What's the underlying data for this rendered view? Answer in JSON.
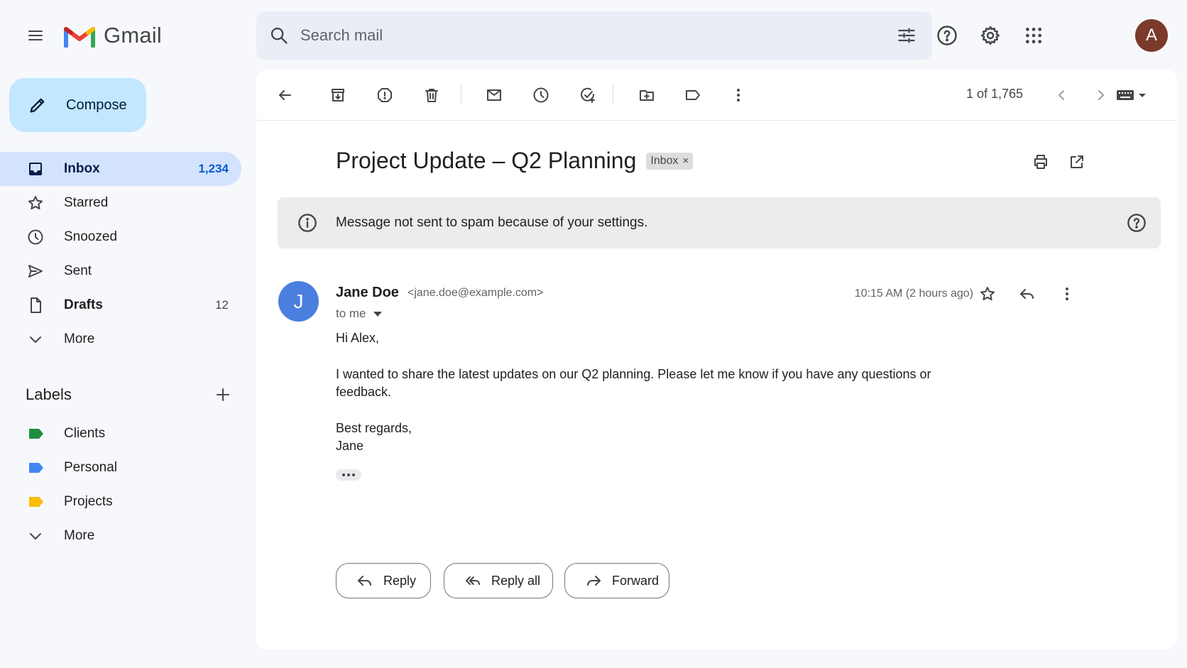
{
  "app": {
    "name": "Gmail"
  },
  "header": {
    "search_placeholder": "Search mail",
    "avatar_initial": "A",
    "icons": [
      "menu-icon",
      "search-icon",
      "tune-icon",
      "help-icon",
      "settings-icon",
      "apps-icon"
    ]
  },
  "sidebar": {
    "compose_label": "Compose",
    "items": [
      {
        "label": "Inbox",
        "count": "1,234",
        "icon": "inbox-icon",
        "active": true
      },
      {
        "label": "Starred",
        "count": "",
        "icon": "star-icon"
      },
      {
        "label": "Snoozed",
        "count": "",
        "icon": "clock-icon"
      },
      {
        "label": "Sent",
        "count": "",
        "icon": "send-icon"
      },
      {
        "label": "Drafts",
        "count": "12",
        "icon": "draft-icon"
      },
      {
        "label": "More",
        "count": "",
        "icon": "chevron-down-icon"
      }
    ],
    "labels_heading": "Labels",
    "labels": [
      {
        "label": "Clients",
        "color": "#1e8e3e"
      },
      {
        "label": "Personal",
        "color": "#4285f4"
      },
      {
        "label": "Projects",
        "color": "#fbbc04"
      }
    ],
    "labels_more": "More"
  },
  "toolbar": {
    "pager": "1 of 1,765",
    "icons": [
      "back-arrow-icon",
      "archive-icon",
      "report-spam-icon",
      "delete-icon",
      "mark-unread-icon",
      "snooze-icon",
      "add-task-icon",
      "move-to-icon",
      "label-icon",
      "more-vert-icon",
      "chevron-left-icon",
      "chevron-right-icon",
      "keyboard-icon"
    ]
  },
  "email": {
    "subject": "Project Update – Q2 Planning",
    "chip_label": "Inbox",
    "chip_close": "×",
    "spam_notice": "Message not sent to spam because of your settings.",
    "sender_initial": "J",
    "sender_name": "Jane Doe",
    "sender_email": "<jane.doe@example.com>",
    "recipient": "to me",
    "timestamp": "10:15 AM (2 hours ago)",
    "body": {
      "greeting": "Hi Alex,",
      "paragraph_line1": "I wanted to share the latest updates on our Q2 planning. Please let me know if you have any questions or",
      "paragraph_line2": "feedback.",
      "closing": "Best regards,",
      "signature": "Jane"
    },
    "actions": {
      "reply": "Reply",
      "reply_all": "Reply all",
      "forward": "Forward"
    }
  },
  "colors": {
    "background": "#f6f8fc",
    "compose": "#c2e7ff",
    "active_nav": "#d3e3fd",
    "sender_avatar": "#4a7fe0",
    "user_avatar": "#7b3a2a"
  }
}
